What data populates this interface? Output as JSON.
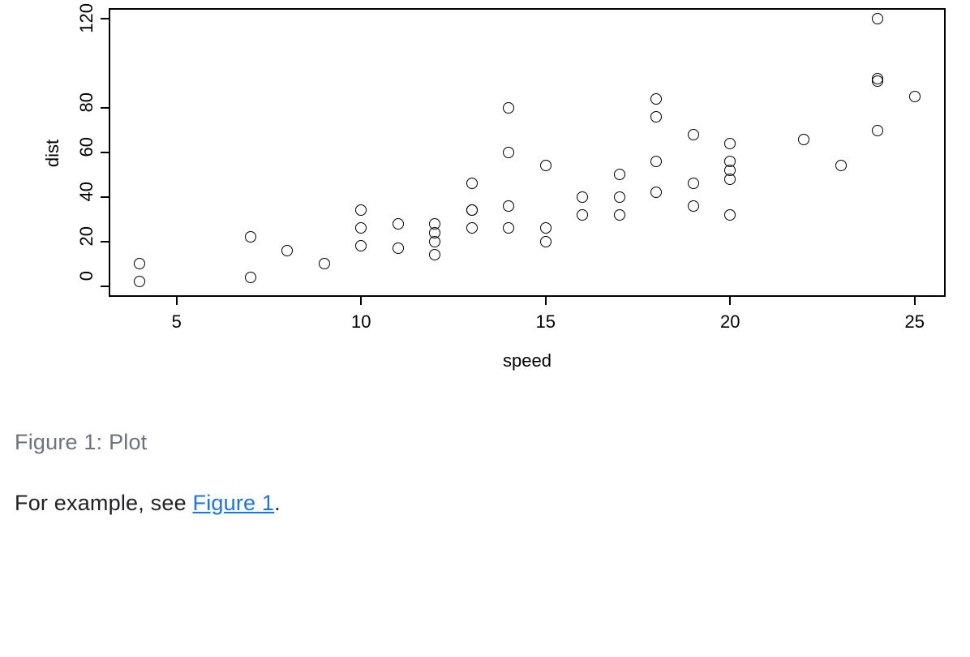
{
  "chart_data": {
    "type": "scatter",
    "xlabel": "speed",
    "ylabel": "dist",
    "xlim": [
      4,
      25
    ],
    "ylim": [
      0,
      120
    ],
    "x_ticks": [
      5,
      10,
      15,
      20,
      25
    ],
    "y_ticks": [
      0,
      20,
      40,
      60,
      80,
      120
    ],
    "x": [
      4,
      4,
      7,
      7,
      8,
      9,
      10,
      10,
      10,
      11,
      11,
      12,
      12,
      12,
      12,
      13,
      13,
      13,
      13,
      14,
      14,
      14,
      14,
      15,
      15,
      15,
      16,
      16,
      17,
      17,
      17,
      18,
      18,
      18,
      18,
      19,
      19,
      19,
      20,
      20,
      20,
      20,
      20,
      22,
      23,
      24,
      24,
      24,
      24,
      25
    ],
    "y": [
      2,
      10,
      4,
      22,
      16,
      10,
      18,
      26,
      34,
      17,
      28,
      14,
      20,
      24,
      28,
      26,
      34,
      34,
      46,
      26,
      36,
      60,
      80,
      20,
      26,
      54,
      32,
      40,
      32,
      40,
      50,
      42,
      56,
      76,
      84,
      36,
      46,
      68,
      32,
      48,
      52,
      56,
      64,
      66,
      54,
      70,
      92,
      93,
      120,
      85
    ]
  },
  "caption_prefix": "Figure 1:",
  "caption_title": "Plot",
  "body_prefix": "For example, see ",
  "body_link_text": "Figure 1",
  "body_suffix": "."
}
